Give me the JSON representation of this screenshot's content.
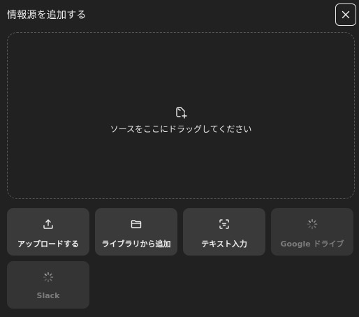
{
  "dialog": {
    "title": "情報源を追加する",
    "close_icon": "close-icon"
  },
  "dropzone": {
    "icon": "add-file-icon",
    "text": "ソースをここにドラッグしてください"
  },
  "sources": [
    {
      "label": "アップロードする",
      "icon": "upload-icon",
      "enabled": true
    },
    {
      "label": "ライブラリから追加",
      "icon": "folder-icon",
      "enabled": true
    },
    {
      "label": "テキスト入力",
      "icon": "text-scan-icon",
      "enabled": true
    },
    {
      "label": "Google ドライブ",
      "icon": "loading-spinner-icon",
      "enabled": false
    },
    {
      "label": "Slack",
      "icon": "loading-spinner-icon",
      "enabled": false
    }
  ],
  "colors": {
    "background": "#212121",
    "tile": "#3a3a3a",
    "tile_disabled": "#343434",
    "dashed_border": "#565656",
    "disabled_text": "#7c7c7c"
  }
}
